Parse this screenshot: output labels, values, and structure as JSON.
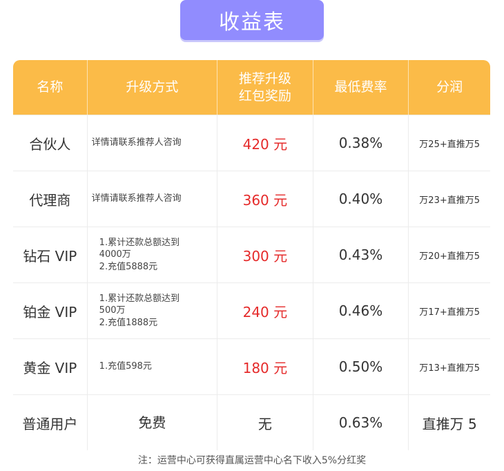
{
  "title": "收益表",
  "headers": [
    "名称",
    "升级方式",
    "推荐升级\n红包奖励",
    "最低费率",
    "分润"
  ],
  "header_lines": {
    "col0": "名称",
    "col1": "升级方式",
    "col2_line1": "推荐升级",
    "col2_line2": "红包奖励",
    "col3": "最低费率",
    "col4": "分润"
  },
  "rows": [
    {
      "name": "合伙人",
      "method": [
        "详情请联系推荐人咨询"
      ],
      "reward": "420 元",
      "rate": "0.38%",
      "share": "万25+直推万5"
    },
    {
      "name": "代理商",
      "method": [
        "详情请联系推荐人咨询"
      ],
      "reward": "360 元",
      "rate": "0.40%",
      "share": "万23+直推万5"
    },
    {
      "name": "钻石 VIP",
      "method": [
        "1.累计还款总额达到",
        "4000万",
        "2.充值5888元"
      ],
      "reward": "300 元",
      "rate": "0.43%",
      "share": "万20+直推万5"
    },
    {
      "name": "铂金 VIP",
      "method": [
        "1.累计还款总额达到",
        "500万",
        "2.充值1888元"
      ],
      "reward": "240 元",
      "rate": "0.46%",
      "share": "万17+直推万5"
    },
    {
      "name": "黄金 VIP",
      "method": [
        "1.充值598元"
      ],
      "reward": "180 元",
      "rate": "0.50%",
      "share": "万13+直推万5"
    },
    {
      "name": "普通用户",
      "method": [
        "免费"
      ],
      "reward": "无",
      "rate": "0.63%",
      "share": "直推万 5"
    }
  ],
  "footnote": "注：运营中心可获得直属运营中心名下收入5%分红奖",
  "colors": {
    "title_bg": "#918cfe",
    "header_bg": "#fbbb48",
    "reward_red": "#e52a2a"
  }
}
